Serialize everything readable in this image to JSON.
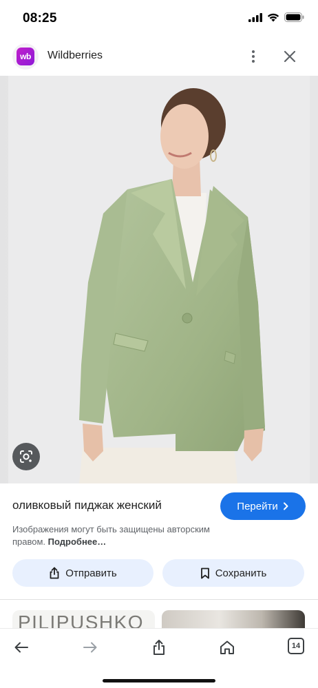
{
  "status_bar": {
    "time": "08:25",
    "icons": [
      "signal-icon",
      "wifi-icon",
      "battery-icon"
    ]
  },
  "header": {
    "site_logo_text": "wb",
    "site_name": "Wildberries",
    "more_icon": "more-vert-icon",
    "close_icon": "close-icon"
  },
  "image": {
    "lens_icon": "google-lens-icon"
  },
  "result": {
    "title": "оливковый пиджак женский",
    "go_button_label": "Перейти",
    "copyright_text": "Изображения могут быть защищены авторским правом.",
    "more_link": "Подробнее…"
  },
  "actions": {
    "share_label": "Отправить",
    "save_label": "Сохранить"
  },
  "related": {
    "thumb1_text": "PILIPUSHKO"
  },
  "bottom_nav": {
    "tabs_count": "14"
  },
  "colors": {
    "accent": "#1a73e8",
    "chip_bg": "#e8f0fe",
    "brand": "#a11ad0",
    "jacket": "#a3b88a"
  }
}
